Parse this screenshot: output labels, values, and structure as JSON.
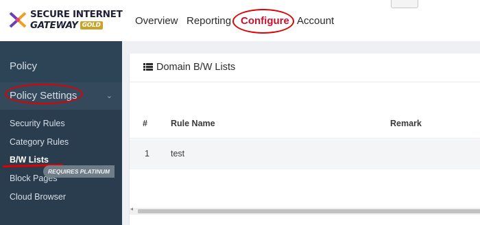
{
  "brand": {
    "line1": "SECURE INTERNET",
    "line2": "GATEWAY",
    "badge": "GOLD",
    "colors": {
      "badge": "#c9a227",
      "mark_purple": "#6a3fb5",
      "mark_orange": "#f0a020"
    }
  },
  "top_nav": {
    "items": [
      {
        "label": "Overview",
        "active": false
      },
      {
        "label": "Reporting",
        "active": false
      },
      {
        "label": "Configure",
        "active": true
      },
      {
        "label": "Account",
        "active": false
      }
    ],
    "active_color": "#c8102e",
    "collapse_icon": "chevron-up-icon"
  },
  "sidebar": {
    "section_policy": "Policy",
    "section_policy_settings": "Policy Settings",
    "settings_chevron": "chevron-down-icon",
    "sub_items": [
      {
        "label": "Security Rules",
        "active": false
      },
      {
        "label": "Category Rules",
        "active": false
      },
      {
        "label": "B/W Lists",
        "active": true
      },
      {
        "label": "Block Pages",
        "active": false
      },
      {
        "label": "Cloud Browser",
        "active": false
      }
    ],
    "requires_badge": "REQUIRES PLATINUM",
    "colors": {
      "background": "#2d4356",
      "text": "#d7dee5"
    }
  },
  "panel": {
    "title": "Domain B/W Lists",
    "title_icon": "list-icon",
    "table": {
      "columns": [
        "#",
        "Rule Name",
        "Remark"
      ],
      "rows": [
        {
          "num": "1",
          "rule_name": "test",
          "remark": ""
        }
      ]
    }
  },
  "annotations": {
    "color": "#e00000",
    "highlighted": [
      "Configure",
      "Policy Settings",
      "B/W Lists"
    ]
  }
}
